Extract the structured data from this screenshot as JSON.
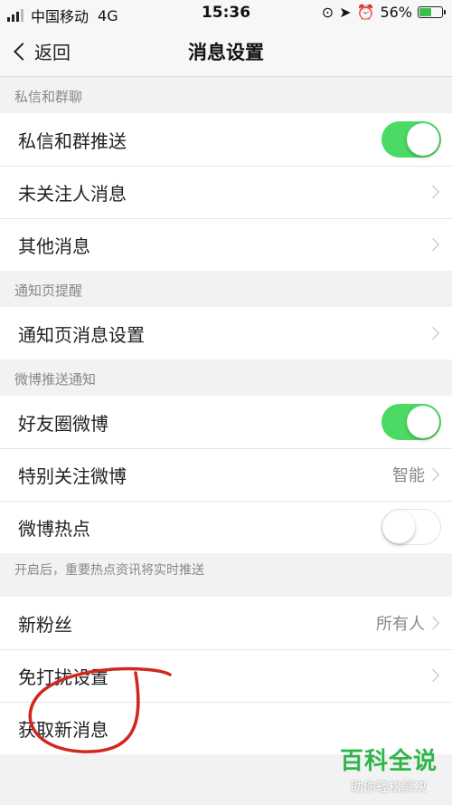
{
  "status_bar": {
    "carrier": "中国移动",
    "network": "4G",
    "time": "15:36",
    "battery": "56%",
    "battery_level": 0.56
  },
  "nav": {
    "back_label": "返回",
    "title": "消息设置"
  },
  "sections": [
    {
      "header": "私信和群聊",
      "rows": [
        {
          "label": "私信和群推送",
          "control": "toggle",
          "on": true
        },
        {
          "label": "未关注人消息",
          "control": "chevron"
        },
        {
          "label": "其他消息",
          "control": "chevron"
        }
      ]
    },
    {
      "header": "通知页提醒",
      "rows": [
        {
          "label": "通知页消息设置",
          "control": "chevron"
        }
      ]
    },
    {
      "header": "微博推送通知",
      "rows": [
        {
          "label": "好友圈微博",
          "control": "toggle",
          "on": true
        },
        {
          "label": "特别关注微博",
          "control": "chevron",
          "value": "智能"
        },
        {
          "label": "微博热点",
          "control": "toggle",
          "on": false
        }
      ],
      "footnote": "开启后，重要热点资讯将实时推送"
    },
    {
      "header": "",
      "rows": [
        {
          "label": "新粉丝",
          "control": "chevron",
          "value": "所有人"
        },
        {
          "label": "免打扰设置",
          "control": "chevron"
        },
        {
          "label": "获取新消息",
          "control": "none"
        }
      ]
    }
  ],
  "watermark": {
    "title": "百科全说",
    "subtitle": "助你轻松解决"
  },
  "colors": {
    "toggle_on": "#4cd964",
    "annotation": "#d0281e",
    "watermark": "#2fb54a"
  }
}
